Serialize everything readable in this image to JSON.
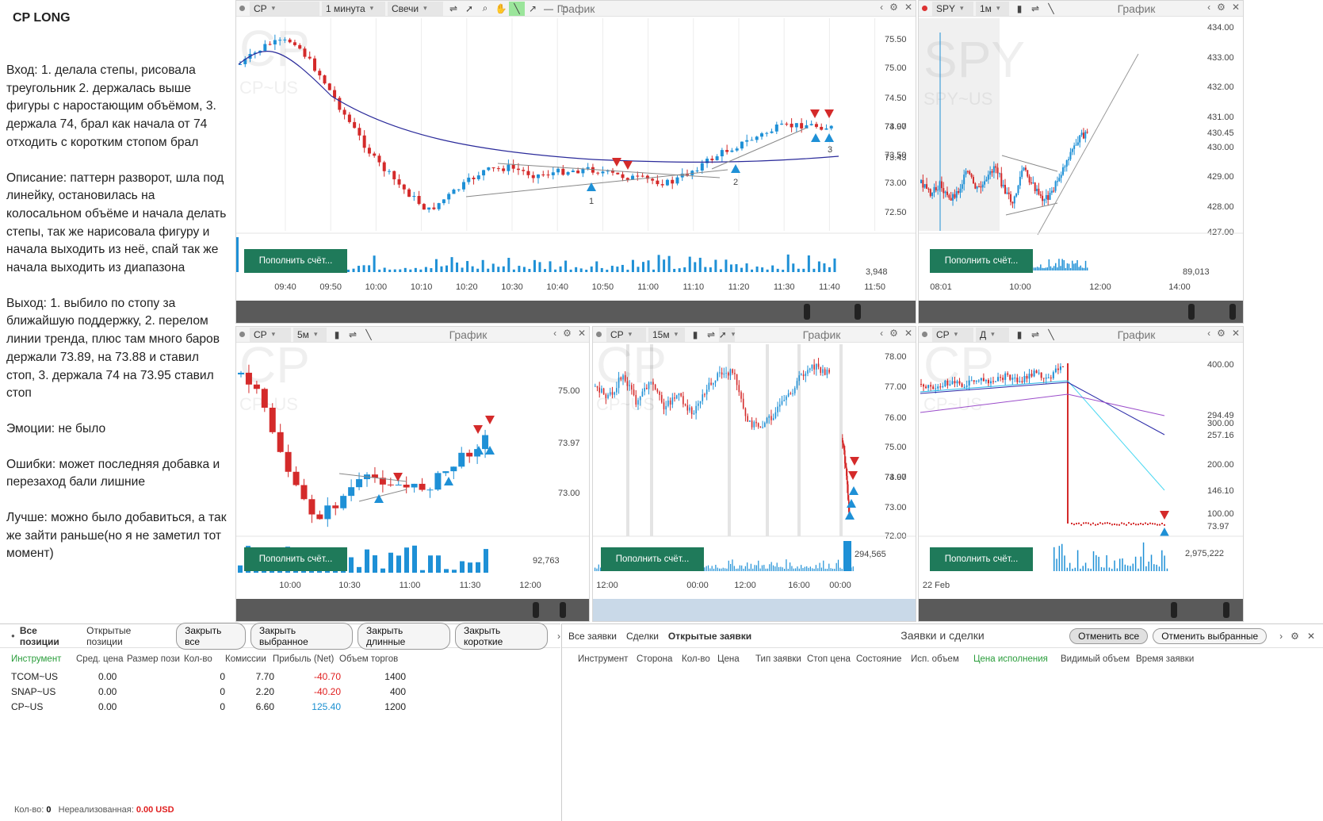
{
  "notes": {
    "title": "CP LONG",
    "entry": "Вход: 1. делала степы, рисовала треугольник 2. держалась выше фигуры с наростающим объёмом, 3. держала 74, брал как начала от 74 отходить с коротким стопом брал",
    "description": "Описание: паттерн разворот, шла под линейку, остановилась на колосальном объёме и начала делать степы, так же нарисовала фигуру и начала выходить из неё, спай так же начала выходить из диапазона",
    "exit": "Выход: 1. выбило по стопу за ближайшую поддержку, 2. перелом линии тренда, плюс там много баров держали 73.89, на 73.88 и ставил стоп, 3. держала 74 на 73.95 ставил стоп",
    "emotions": "Эмоции: не было",
    "mistakes": "Ошибки: может последняя добавка и перезаход бали лишние",
    "better": "Лучше: можно было добавиться, а так же зайти раньше(но я не заметил тот момент)"
  },
  "common": {
    "chart_title": "График",
    "deposit_label": "Пополнить счёт..."
  },
  "charts": {
    "main": {
      "symbol": "CP",
      "interval": "1 минута",
      "chart_type": "Свечи",
      "watermark": "CP",
      "watermark_sub": "CP~US",
      "y_ticks": [
        "75.50",
        "75.00",
        "74.50",
        "74.00",
        "73.50",
        "73.00",
        "72.50"
      ],
      "price_label": "73.97",
      "ma_label": "73.43",
      "volume_label": "3,948",
      "x_ticks": [
        "09:40",
        "09:50",
        "10:00",
        "10:10",
        "10:20",
        "10:30",
        "10:40",
        "10:50",
        "11:00",
        "11:10",
        "11:20",
        "11:30",
        "11:40",
        "11:50"
      ],
      "annotations": [
        "1",
        "2",
        "3"
      ]
    },
    "spy": {
      "symbol": "SPY",
      "interval": "1м",
      "watermark": "SPY",
      "watermark_sub": "SPY~US",
      "y_ticks": [
        "434.00",
        "433.00",
        "432.00",
        "431.00",
        "430.00",
        "429.00",
        "428.00",
        "427.00"
      ],
      "price_label": "430.45",
      "volume_label": "89,013",
      "x_ticks": [
        "08:01",
        "10:00",
        "12:00",
        "14:00"
      ]
    },
    "five": {
      "symbol": "CP",
      "interval": "5м",
      "watermark": "CP",
      "watermark_sub": "CP~US",
      "y_ticks": [
        "75.00",
        "73.00"
      ],
      "price_label": "73.97",
      "volume_label": "92,763",
      "x_ticks": [
        "10:00",
        "10:30",
        "11:00",
        "11:30",
        "12:00"
      ]
    },
    "fifteen": {
      "symbol": "CP",
      "interval": "15м",
      "watermark": "CP",
      "watermark_sub": "CP~US",
      "y_ticks": [
        "78.00",
        "77.00",
        "76.00",
        "75.00",
        "74.00",
        "73.00",
        "72.00"
      ],
      "price_label": "73.97",
      "volume_label": "294,565",
      "x_ticks": [
        "12:00",
        "00:00",
        "12:00",
        "16:00",
        "00:00"
      ]
    },
    "daily": {
      "symbol": "CP",
      "interval": "Д",
      "watermark": "CP",
      "watermark_sub": "CP~US",
      "y_ticks": [
        "400.00",
        "300.00",
        "200.00",
        "100.00"
      ],
      "line_labels": [
        "294.49",
        "257.16",
        "146.10",
        "73.97"
      ],
      "volume_label": "2,975,222",
      "x_ticks": [
        "22 Feb"
      ]
    }
  },
  "positions": {
    "tabs": [
      "Все позиции",
      "Открытые позиции"
    ],
    "buttons": [
      "Закрыть все",
      "Закрыть выбранное",
      "Закрыть длинные",
      "Закрыть короткие"
    ],
    "columns": [
      "Инструмент",
      "Сред. цена",
      "Размер пози",
      "Кол-во",
      "Комиссии",
      "Прибыль (Net)",
      "Объем торгов"
    ],
    "rows": [
      {
        "instrument": "TCOM~US",
        "avg": "0.00",
        "size": "0",
        "commission": "7.70",
        "profit": "-40.70",
        "volume": "1400"
      },
      {
        "instrument": "SNAP~US",
        "avg": "0.00",
        "size": "0",
        "commission": "2.20",
        "profit": "-40.20",
        "volume": "400"
      },
      {
        "instrument": "CP~US",
        "avg": "0.00",
        "size": "0",
        "commission": "6.60",
        "profit": "125.40",
        "volume": "1200"
      }
    ],
    "footer_qty_label": "Кол-во:",
    "footer_qty": "0",
    "footer_unreal_label": "Нереализованная:",
    "footer_unreal": "0.00 USD"
  },
  "orders": {
    "tabs": [
      "Все заявки",
      "Сделки",
      "Открытые заявки"
    ],
    "title": "Заявки и сделки",
    "buttons": [
      "Отменить все",
      "Отменить выбранные"
    ],
    "columns": [
      "Инструмент",
      "Сторона",
      "Кол-во",
      "Цена",
      "Тип заявки",
      "Стоп цена",
      "Состояние",
      "Исп. объем",
      "Цена исполнения",
      "Видимый объем",
      "Время заявки"
    ]
  },
  "colors": {
    "up": "#1e90d6",
    "down": "#d42a2a",
    "deposit": "#1f7a5a",
    "ma": "#2a2a9a"
  }
}
